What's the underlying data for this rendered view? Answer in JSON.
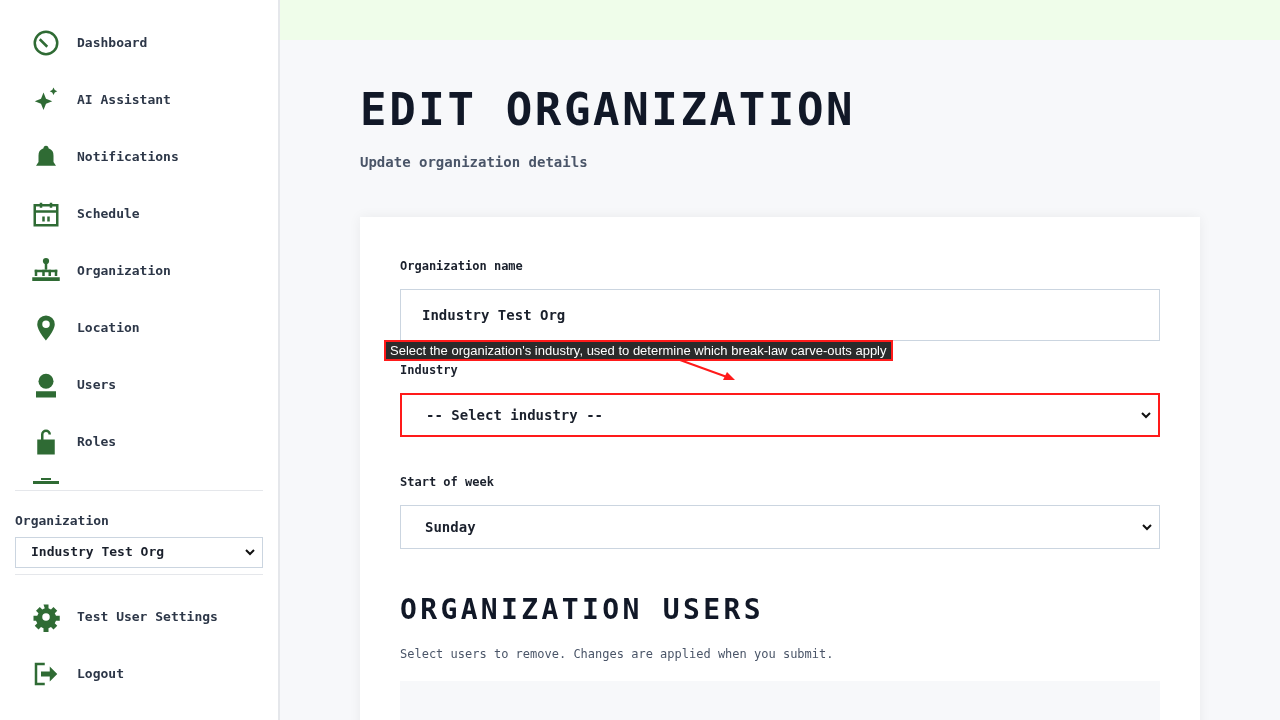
{
  "sidebar": {
    "items": [
      {
        "label": "Dashboard"
      },
      {
        "label": "AI Assistant"
      },
      {
        "label": "Notifications"
      },
      {
        "label": "Schedule"
      },
      {
        "label": "Organization"
      },
      {
        "label": "Location"
      },
      {
        "label": "Users"
      },
      {
        "label": "Roles"
      }
    ],
    "org_switcher": {
      "label": "Organization",
      "value": "Industry Test Org"
    },
    "footer_items": [
      {
        "label": "Test User Settings"
      },
      {
        "label": "Logout"
      }
    ]
  },
  "page": {
    "title": "EDIT ORGANIZATION",
    "subtitle": "Update organization details"
  },
  "form": {
    "fields": [
      {
        "kind": "text",
        "label": "Organization name",
        "value": "Industry Test Org",
        "highlighted": false
      },
      {
        "kind": "select",
        "label": "Industry",
        "value": "-- Select industry --",
        "highlighted": true,
        "tooltip": "Select the organization's industry, used to determine which break-law carve-outs apply"
      },
      {
        "kind": "select",
        "label": "Start of week",
        "value": "Sunday",
        "highlighted": false
      }
    ]
  },
  "users_section": {
    "title": "ORGANIZATION USERS",
    "description": "Select users to remove. Changes are applied when you submit."
  }
}
